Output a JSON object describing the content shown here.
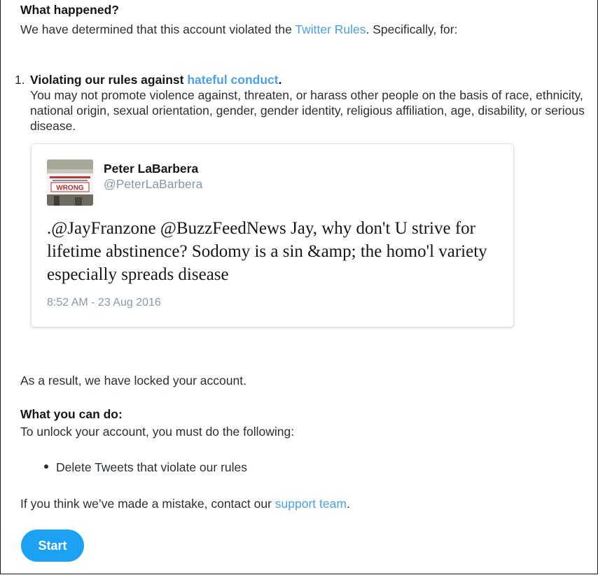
{
  "what_happened": {
    "heading": "What happened?",
    "text_before": "We have determined that this account violated the ",
    "rules_link": "Twitter Rules",
    "text_after": ". Specifically, for:"
  },
  "violation": {
    "number": "1.",
    "title_before": "Violating our rules against ",
    "title_link": "hateful conduct",
    "title_after": ".",
    "description": "You may not promote violence against, threaten, or harass other people on the basis of race, ethnicity, national origin, sexual orientation, gender, gender identity, religious affiliation, age, disability, or serious disease."
  },
  "tweet": {
    "author_name": "Peter LaBarbera",
    "author_handle": "@PeterLaBarbera",
    "avatar_sign_text": "WRONG",
    "text": ".@JayFranzone @BuzzFeedNews Jay, why don't U strive for lifetime abstinence? Sodomy is a sin &amp; the homo'l variety especially spreads disease",
    "timestamp": "8:52 AM - 23 Aug 2016"
  },
  "result": {
    "text": "As a result, we have locked your account."
  },
  "what_you_can_do": {
    "heading": "What you can do:",
    "intro": "To unlock your account, you must do the following:",
    "steps": [
      "Delete Tweets that violate our rules"
    ]
  },
  "mistake": {
    "text_before": "If you think we’ve made a mistake, contact our ",
    "support_link": "support team",
    "text_after": "."
  },
  "start_button": {
    "label": "Start"
  },
  "colors": {
    "link": "#4aa0e6",
    "button": "#1da1f2",
    "handle": "#8899a6"
  }
}
